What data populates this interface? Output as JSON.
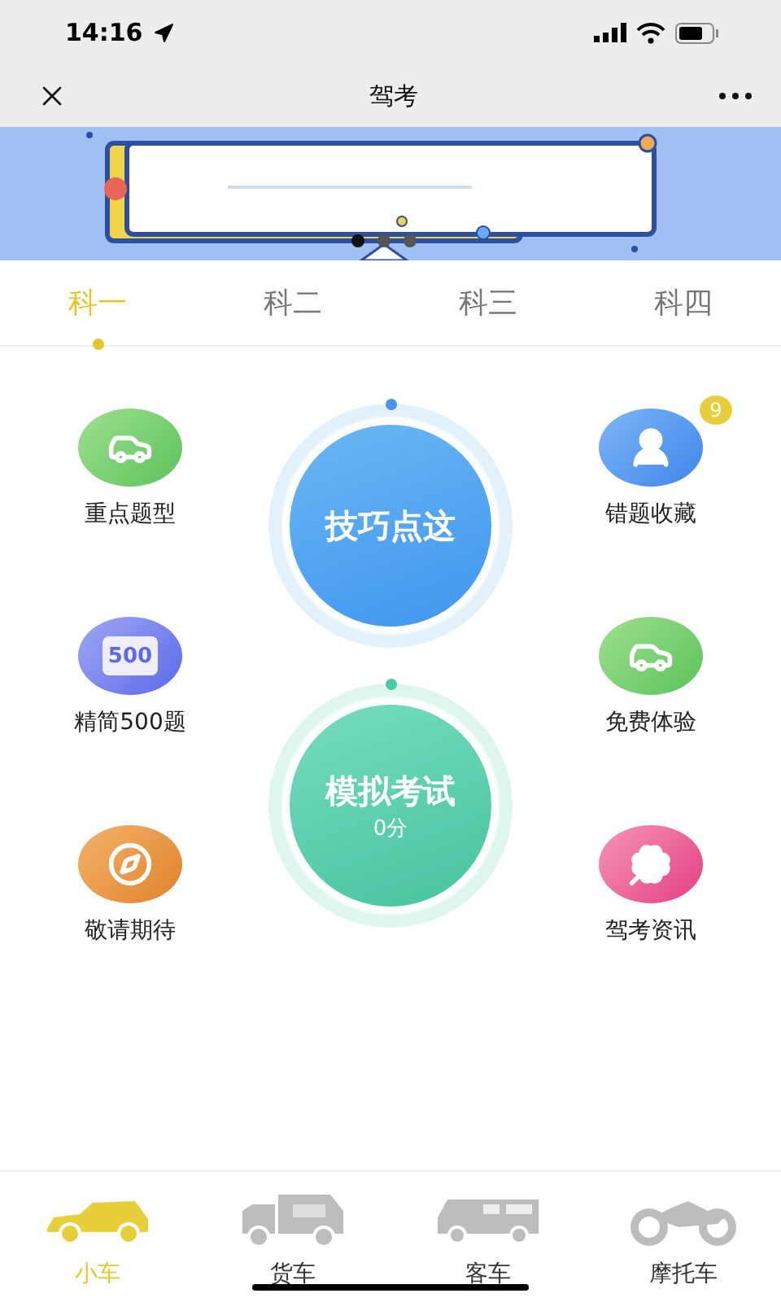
{
  "status_bar": {
    "time": "14:16"
  },
  "nav_bar": {
    "title": "驾考"
  },
  "banner": {
    "dots": [
      {
        "selected": true
      },
      {
        "selected": false
      },
      {
        "selected": false
      }
    ]
  },
  "tabs": [
    {
      "label": "科一",
      "selected": true
    },
    {
      "label": "科二",
      "selected": false
    },
    {
      "label": "科三",
      "selected": false
    },
    {
      "label": "科四",
      "selected": false
    }
  ],
  "left_items": [
    {
      "label": "重点题型",
      "kind": "car"
    },
    {
      "label": "精简500题",
      "kind": "sign",
      "icon_text": "500"
    },
    {
      "label": "敬请期待",
      "kind": "compass"
    }
  ],
  "right_items": [
    {
      "label": "错题收藏",
      "kind": "person",
      "badge": "9"
    },
    {
      "label": "免费体验",
      "kind": "car"
    },
    {
      "label": "驾考资讯",
      "kind": "clover"
    }
  ],
  "center_buttons": [
    {
      "label": "技巧点这",
      "kind": "tips"
    },
    {
      "label": "模拟考试",
      "kind": "exam",
      "score": "0分"
    }
  ],
  "bottom_tabs": [
    {
      "label": "小车",
      "kind": "car",
      "selected": true
    },
    {
      "label": "货车",
      "kind": "truck",
      "selected": false
    },
    {
      "label": "客车",
      "kind": "bus",
      "selected": false
    },
    {
      "label": "摩托车",
      "kind": "motorcycle",
      "selected": false
    }
  ]
}
